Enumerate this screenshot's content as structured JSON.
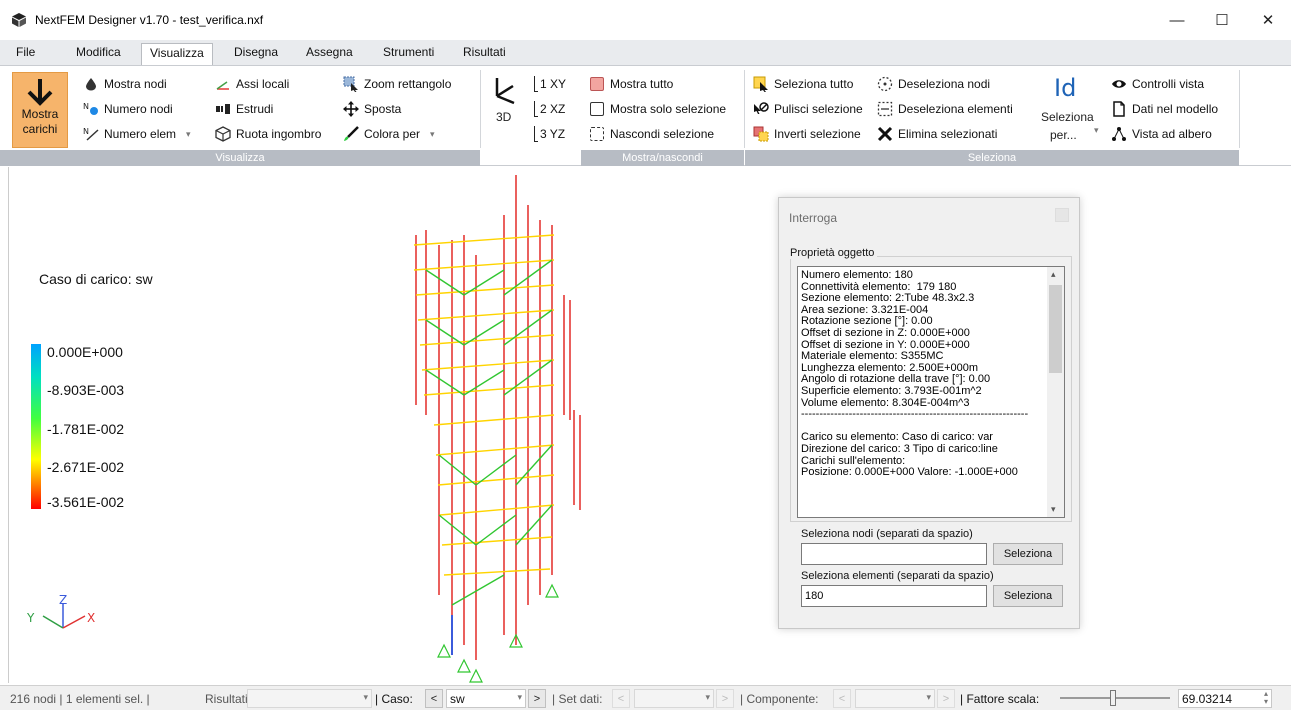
{
  "window": {
    "title": "NextFEM Designer v1.70 - test_verifica.nxf",
    "minimize": "—",
    "maximize": "☐",
    "close": "✕"
  },
  "menu": [
    "File",
    "Modifica",
    "Visualizza",
    "Disegna",
    "Assegna",
    "Strumenti",
    "Risultati"
  ],
  "ribbon": {
    "visualizza": {
      "show_loads": [
        "Mostra",
        "carichi"
      ],
      "show_nodes": "Mostra nodi",
      "node_numbers": "Numero nodi",
      "elem_numbers": "Numero elem",
      "local_axes": "Assi locali",
      "extrude": "Estrudi",
      "rotate_bbox": "Ruota ingombro",
      "zoom_rect": "Zoom rettangolo",
      "move": "Sposta",
      "color_by": "Colora per",
      "group_label": "Visualizza"
    },
    "views": {
      "view_3d": "3D",
      "xy": "1 XY",
      "xz": "2 XZ",
      "yz": "3 YZ"
    },
    "mostra_nascondi": {
      "show_all": "Mostra tutto",
      "show_selection_only": "Mostra solo selezione",
      "hide_selection": "Nascondi selezione",
      "group_label": "Mostra/nascondi"
    },
    "seleziona": {
      "select_all": "Seleziona tutto",
      "clear_selection": "Pulisci selezione",
      "invert_selection": "Inverti selezione",
      "deselect_nodes": "Deseleziona nodi",
      "deselect_elements": "Deseleziona elementi",
      "delete_selected": "Elimina selezionati",
      "select_by_id": "Id",
      "select_by": [
        "Seleziona",
        "per..."
      ],
      "view_controls": "Controlli vista",
      "model_data": "Dati nel modello",
      "tree_view": "Vista ad albero",
      "group_label": "Seleziona"
    }
  },
  "viewport": {
    "load_case": "Caso di carico: sw",
    "legend": [
      "0.000E+000",
      "-8.903E-003",
      "-1.781E-002",
      "-2.671E-002",
      "-3.561E-002"
    ],
    "axes": {
      "y": "Y",
      "z": "Z",
      "x": "X"
    }
  },
  "query_window": {
    "title": "Interroga",
    "group_title": "Proprietà oggetto",
    "properties": [
      "Numero elemento: 180",
      "Connettività elemento:  179 180",
      "Sezione elemento: 2:Tube 48.3x2.3",
      "Area sezione: 3.321E-004",
      "Rotazione sezione [°]: 0.00",
      "Offset di sezione in Z: 0.000E+000",
      "Offset di sezione in Y: 0.000E+000",
      "Materiale elemento: S355MC",
      "Lunghezza elemento: 2.500E+000m",
      "Angolo di rotazione della trave [°]: 0.00",
      "Superficie elemento: 3.793E-001m^2",
      "Volume elemento: 8.304E-004m^3",
      "--------------------------------------------------------------",
      "",
      "Carico su elemento: Caso di carico: var",
      "Direzione del carico: 3 Tipo di carico:line",
      "Carichi sull'elemento:",
      "Posizione: 0.000E+000 Valore: -1.000E+000"
    ],
    "select_nodes_label": "Seleziona nodi (separati da spazio)",
    "select_nodes_value": "",
    "select_nodes_button": "Seleziona",
    "select_elements_label": "Seleziona elementi (separati da spazio)",
    "select_elements_value": "180",
    "select_elements_button": "Seleziona"
  },
  "statusbar": {
    "counts": "216 nodi  |  1 elementi sel.  |",
    "results_label": "Risultati:",
    "case_label": "| Caso:",
    "case_value": "sw",
    "dataset_label": "| Set dati:",
    "component_label": "| Componente:",
    "scale_label": "| Fattore scala:",
    "scale_value": "69.03214",
    "prev": "<",
    "next": ">"
  },
  "colors": {
    "accent_button": "#f6b46b",
    "ribbon_group": "#b7bcc4",
    "legend_top": "#00a2ff",
    "legend_bottom": "#ff0000"
  }
}
